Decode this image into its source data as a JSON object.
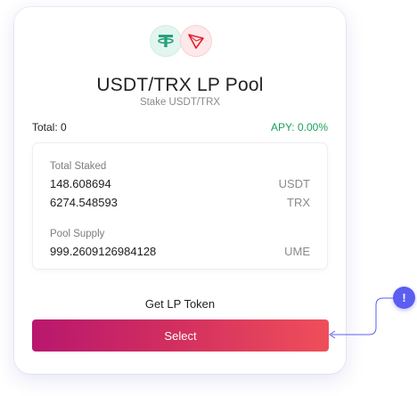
{
  "pool": {
    "title": "USDT/TRX LP Pool",
    "subtitle": "Stake USDT/TRX",
    "tokens": [
      {
        "symbol": "USDT",
        "icon": "tether-icon",
        "color": "#26a17b"
      },
      {
        "symbol": "TRX",
        "icon": "tron-icon",
        "color": "#e5202e"
      }
    ]
  },
  "summary": {
    "total": "Total: 0",
    "apy": "APY: 0.00%",
    "apy_color": "#1aa15b"
  },
  "staked": {
    "label": "Total Staked",
    "rows": [
      {
        "value": "148.608694",
        "unit": "USDT"
      },
      {
        "value": "6274.548593",
        "unit": "TRX"
      }
    ]
  },
  "supply": {
    "label": "Pool Supply",
    "value": "999.2609126984128",
    "unit": "UME"
  },
  "actions": {
    "get_lp_label": "Get LP Token",
    "select_label": "Select"
  },
  "hint": {
    "icon": "info-icon",
    "symbol": "!",
    "color": "#5b5ef0"
  }
}
